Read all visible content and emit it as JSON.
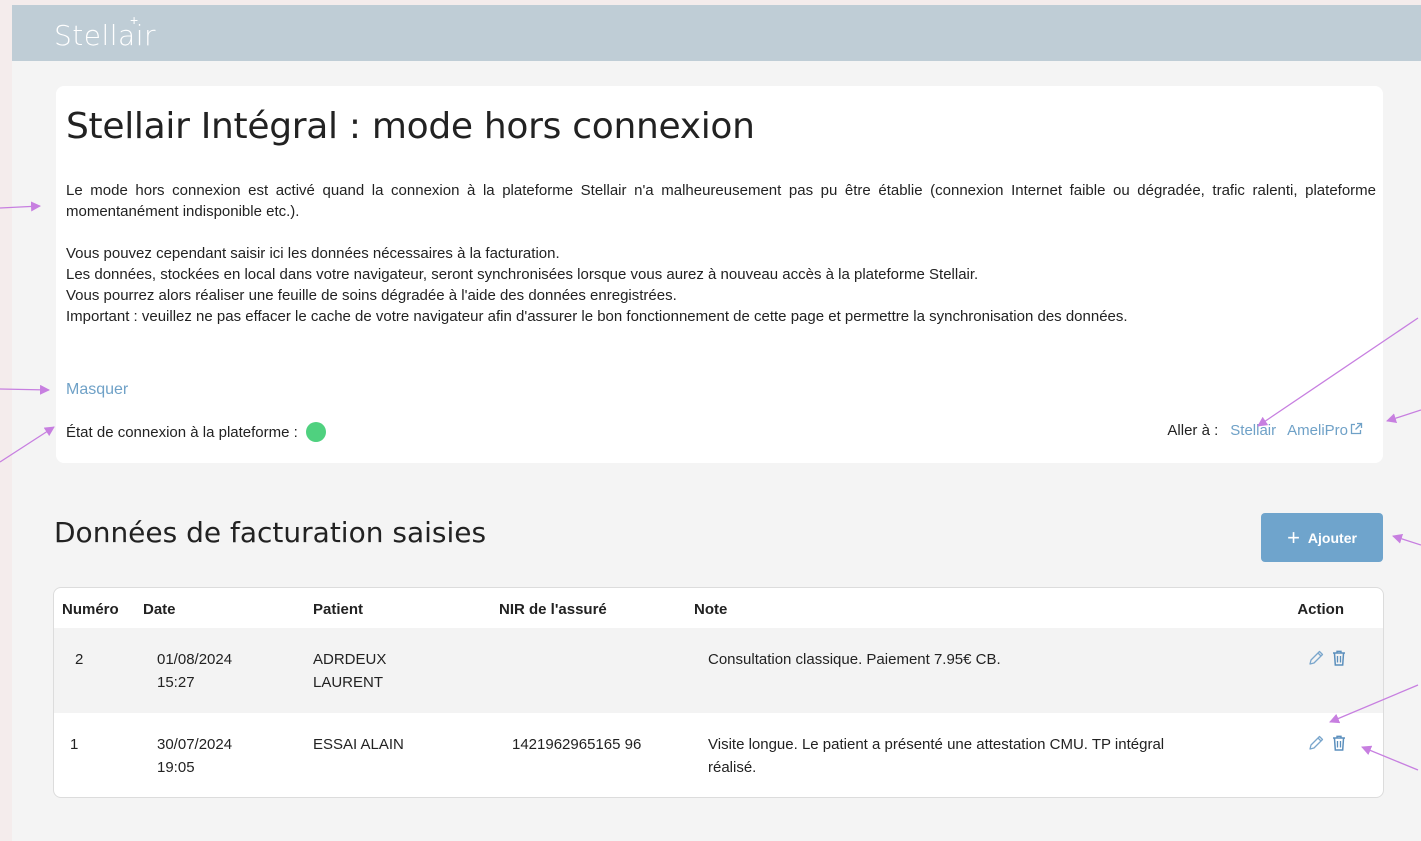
{
  "brand": {
    "logo_text": "Stellair"
  },
  "info": {
    "title": "Stellair Intégral : mode hors connexion",
    "paragraph1": "Le mode hors connexion est activé quand la connexion à la plateforme Stellair n'a malheureusement pas pu être établie (connexion Internet faible ou dégradée, trafic ralenti, plateforme momentanément indisponible etc.).",
    "line2": "Vous pouvez cependant saisir ici les données nécessaires à la facturation.",
    "line3": "Les données, stockées en local dans votre navigateur, seront synchronisées lorsque vous aurez à nouveau accès à la plateforme Stellair.",
    "line4": "Vous pourrez alors réaliser une feuille de soins dégradée à l'aide des données enregistrées.",
    "line5": "Important : veuillez ne pas effacer le cache de votre navigateur afin d'assurer le bon fonctionnement de cette page et permettre la synchronisation des données.",
    "toggle_label": "Masquer",
    "status_label": "État de connexion à la plateforme :",
    "status_color": "#4fd17f",
    "goto_label": "Aller à :",
    "goto_links": [
      "Stellair",
      "AmeliPro"
    ]
  },
  "billing": {
    "title": "Données de facturation saisies",
    "add_label": "Ajouter",
    "columns": [
      "Numéro",
      "Date",
      "Patient",
      "NIR de l'assuré",
      "Note",
      "Action"
    ],
    "rows": [
      {
        "numero": "2",
        "date": "01/08/2024",
        "time": "15:27",
        "patient_line1": "ADRDEUX",
        "patient_line2": "LAURENT",
        "nir": "",
        "note_line1": "Consultation classique. Paiement 7.95€ CB.",
        "note_line2": ""
      },
      {
        "numero": "1",
        "date": "30/07/2024",
        "time": "19:05",
        "patient_line1": "ESSAI ALAIN",
        "patient_line2": "",
        "nir": "1421962965165 96",
        "note_line1": "Visite longue. Le patient a présenté une attestation CMU. TP intégral",
        "note_line2": "réalisé."
      }
    ]
  },
  "colors": {
    "accent": "#6fa1c7",
    "button": "#6fa4cc",
    "topbar": "#bfcdd6",
    "annotation_arrow": "#c77fe0"
  }
}
